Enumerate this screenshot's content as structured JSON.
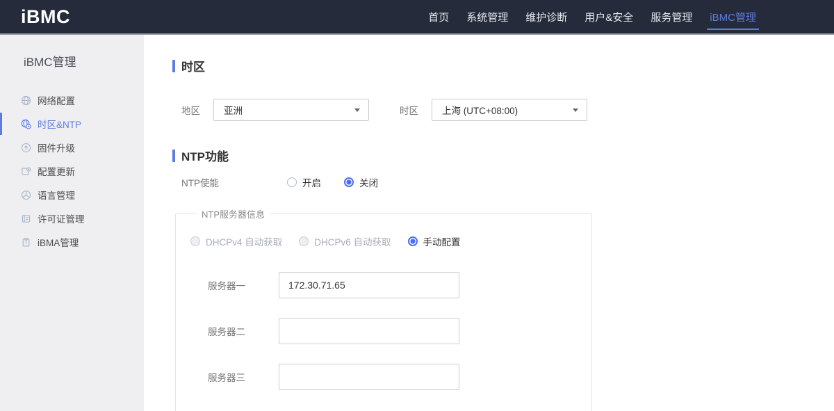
{
  "app": {
    "logo": "iBMC"
  },
  "topnav": {
    "items": [
      {
        "label": "首页",
        "active": false
      },
      {
        "label": "系统管理",
        "active": false
      },
      {
        "label": "维护诊断",
        "active": false
      },
      {
        "label": "用户&安全",
        "active": false
      },
      {
        "label": "服务管理",
        "active": false
      },
      {
        "label": "iBMC管理",
        "active": true
      }
    ]
  },
  "sidebar": {
    "title": "iBMC管理",
    "items": [
      {
        "label": "网络配置",
        "icon": "network-globe-icon",
        "active": false
      },
      {
        "label": "时区&NTP",
        "icon": "timezone-clock-icon",
        "active": true
      },
      {
        "label": "固件升级",
        "icon": "firmware-upgrade-icon",
        "active": false
      },
      {
        "label": "配置更新",
        "icon": "config-update-icon",
        "active": false
      },
      {
        "label": "语言管理",
        "icon": "language-icon",
        "active": false
      },
      {
        "label": "许可证管理",
        "icon": "license-icon",
        "active": false
      },
      {
        "label": "iBMA管理",
        "icon": "ibma-clipboard-icon",
        "active": false
      }
    ]
  },
  "timezone_section": {
    "title": "时区",
    "region_label": "地区",
    "region_value": "亚洲",
    "timezone_label": "时区",
    "timezone_value": "上海 (UTC+08:00)"
  },
  "ntp_section": {
    "title": "NTP功能",
    "enable_label": "NTP使能",
    "enable_options": [
      {
        "label": "开启",
        "selected": false
      },
      {
        "label": "关闭",
        "selected": true
      }
    ],
    "server_group": {
      "legend": "NTP服务器信息",
      "mode_options": [
        {
          "label": "DHCPv4 自动获取",
          "selected": false,
          "disabled": true
        },
        {
          "label": "DHCPv6 自动获取",
          "selected": false,
          "disabled": true
        },
        {
          "label": "手动配置",
          "selected": true,
          "disabled": false
        }
      ],
      "servers": [
        {
          "label": "服务器一",
          "value": "172.30.71.65"
        },
        {
          "label": "服务器二",
          "value": ""
        },
        {
          "label": "服务器三",
          "value": ""
        }
      ]
    }
  },
  "colors": {
    "accent": "#5e7ce0",
    "radio_selected": "#4d6df2",
    "navbar_bg": "#252b3a",
    "sidebar_bg": "#efeff1"
  }
}
